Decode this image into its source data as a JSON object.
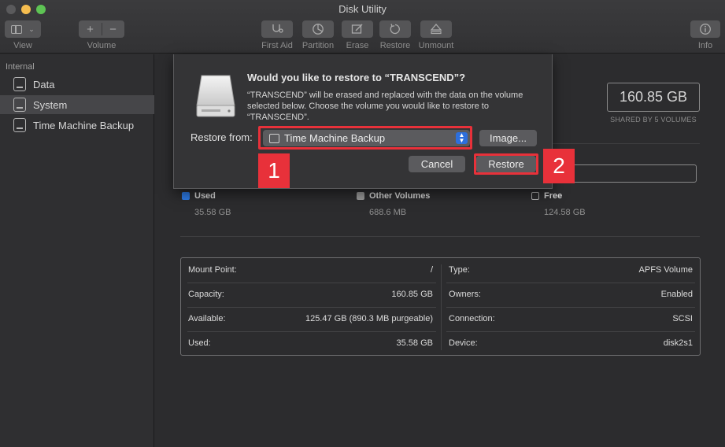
{
  "window": {
    "title": "Disk Utility"
  },
  "toolbar": {
    "view_label": "View",
    "volume_label": "Volume",
    "volume_add": "+",
    "volume_remove": "−",
    "first_aid": "First Aid",
    "partition": "Partition",
    "erase": "Erase",
    "restore": "Restore",
    "unmount": "Unmount",
    "info": "Info"
  },
  "sidebar": {
    "section": "Internal",
    "items": [
      {
        "label": "Data"
      },
      {
        "label": "System"
      },
      {
        "label": "Time Machine Backup"
      }
    ],
    "selected_index": 1
  },
  "main": {
    "capacity": "160.85 GB",
    "shared": "SHARED BY 5 VOLUMES",
    "legend": [
      {
        "label": "Used",
        "value": "35.58 GB",
        "color": "#2e7be5"
      },
      {
        "label": "Other Volumes",
        "value": "688.6 MB",
        "color": "#9a9a9a"
      },
      {
        "label": "Free",
        "value": "124.58 GB",
        "color": "#2c2c2e"
      }
    ],
    "info": [
      {
        "k1": "Mount Point:",
        "v1": "/",
        "k2": "Type:",
        "v2": "APFS Volume"
      },
      {
        "k1": "Capacity:",
        "v1": "160.85 GB",
        "k2": "Owners:",
        "v2": "Enabled"
      },
      {
        "k1": "Available:",
        "v1": "125.47 GB (890.3 MB purgeable)",
        "k2": "Connection:",
        "v2": "SCSI"
      },
      {
        "k1": "Used:",
        "v1": "35.58 GB",
        "k2": "Device:",
        "v2": "disk2s1"
      }
    ]
  },
  "sheet": {
    "title": "Would you like to restore to “TRANSCEND”?",
    "message": "“TRANSCEND” will be erased and replaced with the data on the volume selected below. Choose the volume you would like to restore to “TRANSCEND”.",
    "restore_from_label": "Restore from:",
    "selected_source": "Time Machine Backup",
    "image_button": "Image...",
    "cancel_button": "Cancel",
    "restore_button": "Restore"
  },
  "annotations": {
    "step1": "1",
    "step2": "2",
    "highlight_color": "#e8313a"
  }
}
